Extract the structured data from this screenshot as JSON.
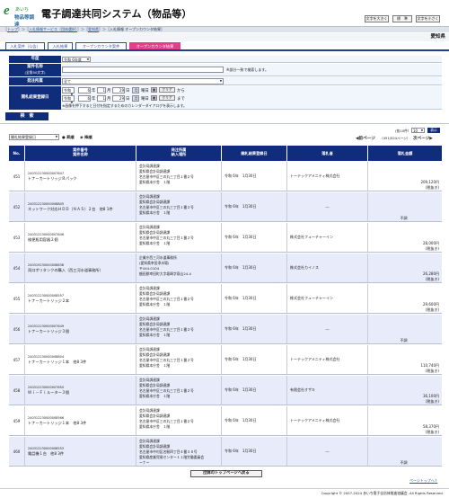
{
  "header": {
    "logo_line1": "あいち",
    "logo_line2": "物品等調達",
    "title": "電子調達共同システム（物品等）",
    "font_btn_large": "文字を大きく",
    "font_btn_std": "標　準",
    "font_btn_small": "文字を小さく"
  },
  "breadcrumb": [
    "トップ",
    "入札情報サービス（団体選択）",
    "愛知県",
    "入札情報 オープンカウンタ結果"
  ],
  "prefecture": "愛知県",
  "tabs": [
    "入札案件（公告）",
    "入札結果",
    "オープンカウンタ案件",
    "オープンカウンタ結果"
  ],
  "search": {
    "year_label": "年度",
    "year_value": "令和 6年度",
    "name_label": "案件名称",
    "name_label2": "(全角50文字)",
    "name_value": "",
    "name_hint": "※部分一致で検索します。",
    "dept_label": "発注所属",
    "dept_value": "全て",
    "date_label": "開札結果登録日",
    "from_era": "令和",
    "from_y": "6",
    "from_m": "1",
    "from_d": "29",
    "from_dow": "月",
    "from_suffix": "曜日",
    "clear": "クリア",
    "from_sep": "から",
    "to_era": "令和",
    "to_y": "6",
    "to_m": "1",
    "to_d": "29",
    "to_dow": "月",
    "to_suffix": "曜日",
    "to_sep": "まで",
    "cal_note": "※画像を押下すると日付を指定するためのカレンダーダイアログを表示します。",
    "button": "検　索"
  },
  "sort": {
    "field": "開札結果登録日",
    "asc": "昇順",
    "desc": "降順"
  },
  "paging": {
    "total": "(各10件）",
    "per_page": "10",
    "per_page_btn": "表示",
    "prev": "前ページ",
    "range": "（451/524ページ）",
    "next": "次ページ"
  },
  "table": {
    "headers": [
      "No.",
      "案件番号\n案件名称",
      "発注所属\n納入場所",
      "開札結果登録日",
      "落札者",
      "落札金額"
    ],
    "rows": [
      {
        "no": "451",
        "num": "240312230000007647",
        "name": "トナーカートリッジＢパック",
        "org": [
          "会計局調達課",
          "愛知県会計局調達課",
          "名古屋市中区三の丸三丁目１番２号",
          "愛知県本庁舎　１階"
        ],
        "date": "令和 6年　1月30日",
        "winner": "トーテックアメニティ株式会社",
        "price": "209,120円",
        "tax": "(税抜き)"
      },
      {
        "no": "452",
        "num": "240312230000008805",
        "name": "ネットワーク対応ＨＤＤ（ＮＡＳ）２台　他8 1件",
        "org": [
          "会計局調達課",
          "愛知県会計局調達課",
          "名古屋市中区三の丸三丁目１番２号",
          "愛知県本庁舎　１階"
        ],
        "date": "令和 6年　1月30日",
        "winner": "---",
        "price": "不調",
        "tax": ""
      },
      {
        "no": "453",
        "num": "240312230000007646",
        "name": "検便瓶用容器２個",
        "org": [
          "会計局調達課",
          "愛知県会計局調達課",
          "名古屋市中区三の丸三丁目１番２号",
          "愛知県本庁舎　１階"
        ],
        "date": "令和 6年　1月30日",
        "winner": "株式会社フューチャーイン",
        "price": "28,000円",
        "tax": "(税抜き)"
      },
      {
        "no": "454",
        "num": "240319230000008638",
        "name": "両口ポリタンクの購入（西三河水道事務所）",
        "org": [
          "企業庁西三河水道事務所",
          "(愛知県幸田浄水場)",
          "〒444-0104",
          "額田郡幸田町大字坂崎字雨山24-4"
        ],
        "date": "令和 6年　1月30日",
        "winner": "株式会社カイノス",
        "price": "26,280円",
        "tax": "(税抜き)"
      },
      {
        "no": "455",
        "num": "240312230000008557",
        "name": "トナーカートリッジ２本",
        "org": [
          "会計局調達課",
          "愛知県会計局調達課",
          "名古屋市中区三の丸三丁目１番２号",
          "愛知県本庁舎　１階"
        ],
        "date": "令和 6年　1月30日",
        "winner": "株式会社フューチャーイン",
        "price": "29,600円",
        "tax": "(税抜き)"
      },
      {
        "no": "456",
        "num": "240312230000007649",
        "name": "トナーカートリッジ３個",
        "org": [
          "会計局調達課",
          "愛知県会計局調達課",
          "名古屋市中区三の丸三丁目１番２号",
          "愛知県本庁舎　１階"
        ],
        "date": "令和 6年　1月30日",
        "winner": "---",
        "price": "不調",
        "tax": ""
      },
      {
        "no": "457",
        "num": "240312230000008804",
        "name": "トナーカートリッジ１本　他8 3件",
        "org": [
          "会計局調達課",
          "愛知県会計局調達課",
          "名古屋市中区三の丸三丁目１番２号",
          "愛知県本庁舎　１階"
        ],
        "date": "令和 6年　1月30日",
        "winner": "トーテックアメニティ株式会社",
        "price": "110,740円",
        "tax": "(税抜き)"
      },
      {
        "no": "458",
        "num": "240312230000007650",
        "name": "Ｗｉ－Ｆｉルーター３個",
        "org": [
          "会計局調達課",
          "愛知県会計局調達課",
          "名古屋市中区三の丸三丁目１番２号",
          "愛知県本庁舎　１階"
        ],
        "date": "令和 6年　1月30日",
        "winner": "有限会社オザキ",
        "price": "36,100円",
        "tax": "(税抜き)"
      },
      {
        "no": "459",
        "num": "240312230000008566",
        "name": "トナーカートリッジ１本　他8 3件",
        "org": [
          "会計局調達課",
          "愛知県会計局調達課",
          "名古屋市中区三の丸三丁目１番２号",
          "愛知県本庁舎　１階"
        ],
        "date": "令和 6年　1月30日",
        "winner": "トーテックアメニティ株式会社",
        "price": "58,370円",
        "tax": "(税抜き)"
      },
      {
        "no": "460",
        "num": "240312230000008553",
        "name": "電話機１台　他8 3件",
        "org": [
          "会計局調達課",
          "愛知県会計局調達課",
          "名古屋市中村区名駅四丁目４番３８号",
          "愛知県産業貿易センター１１階労働委員会",
          "ーナー"
        ],
        "date": "令和 6年　1月30日",
        "winner": "---",
        "price": "不調",
        "tax": ""
      }
    ]
  },
  "bottom": {
    "top_button": "団体のトップページへ戻る",
    "page_top": "ページトップへ",
    "copyright": "Copyright © 2007-2024 あいち電子自治体推進協議会. All Rights Reserved."
  },
  "colors": {
    "navy": "#0f2d7b",
    "pink": "#e23f8b",
    "row_alt": "#e8ebf9"
  }
}
